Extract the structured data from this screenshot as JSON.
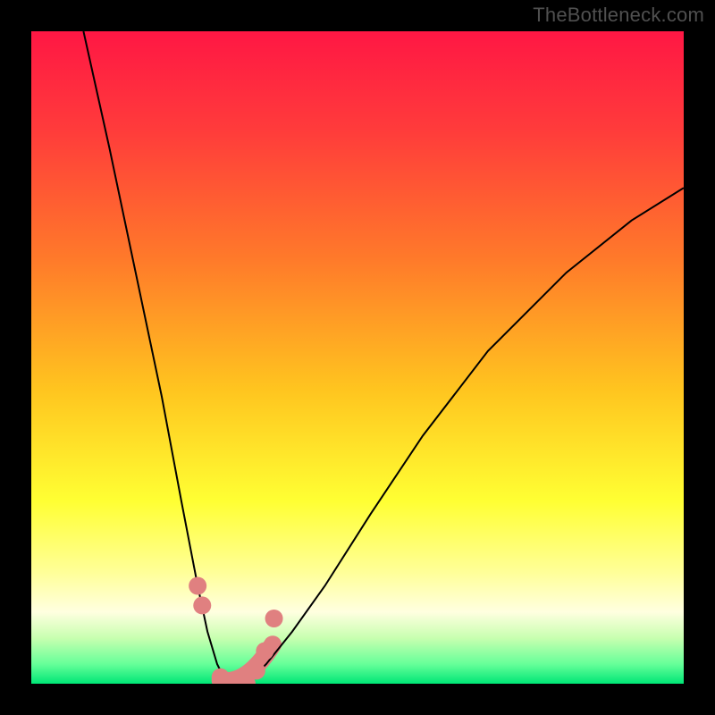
{
  "watermark": "TheBottleneck.com",
  "chart_data": {
    "type": "line",
    "title": "",
    "xlabel": "",
    "ylabel": "",
    "background_gradient": {
      "orientation": "vertical",
      "stops": [
        {
          "position": 0.0,
          "color": "#ff1744"
        },
        {
          "position": 0.15,
          "color": "#ff3b3b"
        },
        {
          "position": 0.35,
          "color": "#ff7a2a"
        },
        {
          "position": 0.55,
          "color": "#ffc51f"
        },
        {
          "position": 0.72,
          "color": "#ffff33"
        },
        {
          "position": 0.83,
          "color": "#ffff99"
        },
        {
          "position": 0.89,
          "color": "#ffffe0"
        },
        {
          "position": 0.93,
          "color": "#c8ffb0"
        },
        {
          "position": 0.97,
          "color": "#66ff99"
        },
        {
          "position": 1.0,
          "color": "#00e676"
        }
      ]
    },
    "curves": [
      {
        "name": "left-branch",
        "color": "#000000",
        "width": 2,
        "description": "steep descending branch from upper-left to trough",
        "x": [
          0.08,
          0.12,
          0.16,
          0.2,
          0.23,
          0.255,
          0.27,
          0.285,
          0.295,
          0.3
        ],
        "y": [
          1.0,
          0.82,
          0.63,
          0.44,
          0.28,
          0.15,
          0.08,
          0.03,
          0.01,
          0.0
        ]
      },
      {
        "name": "right-branch",
        "color": "#000000",
        "width": 2,
        "description": "ascending branch from trough curving to upper-right",
        "x": [
          0.33,
          0.36,
          0.4,
          0.45,
          0.52,
          0.6,
          0.7,
          0.82,
          0.92,
          1.0
        ],
        "y": [
          0.0,
          0.03,
          0.08,
          0.15,
          0.26,
          0.38,
          0.51,
          0.63,
          0.71,
          0.76
        ]
      }
    ],
    "markers": {
      "name": "trough-points",
      "color": "#e08080",
      "radius": 10,
      "description": "pink dots and segments near the trough bottom",
      "points": [
        {
          "x": 0.255,
          "y": 0.15
        },
        {
          "x": 0.262,
          "y": 0.12
        },
        {
          "x": 0.29,
          "y": 0.01
        },
        {
          "x": 0.3,
          "y": 0.0
        },
        {
          "x": 0.315,
          "y": 0.0
        },
        {
          "x": 0.33,
          "y": 0.0
        },
        {
          "x": 0.345,
          "y": 0.02
        },
        {
          "x": 0.358,
          "y": 0.05
        },
        {
          "x": 0.372,
          "y": 0.1
        }
      ],
      "thick_segment": {
        "color": "#e08080",
        "width": 20,
        "from": {
          "x": 0.29,
          "y": 0.005
        },
        "to": {
          "x": 0.37,
          "y": 0.06
        }
      }
    },
    "xlim": [
      0,
      1
    ],
    "ylim": [
      0,
      1
    ]
  }
}
